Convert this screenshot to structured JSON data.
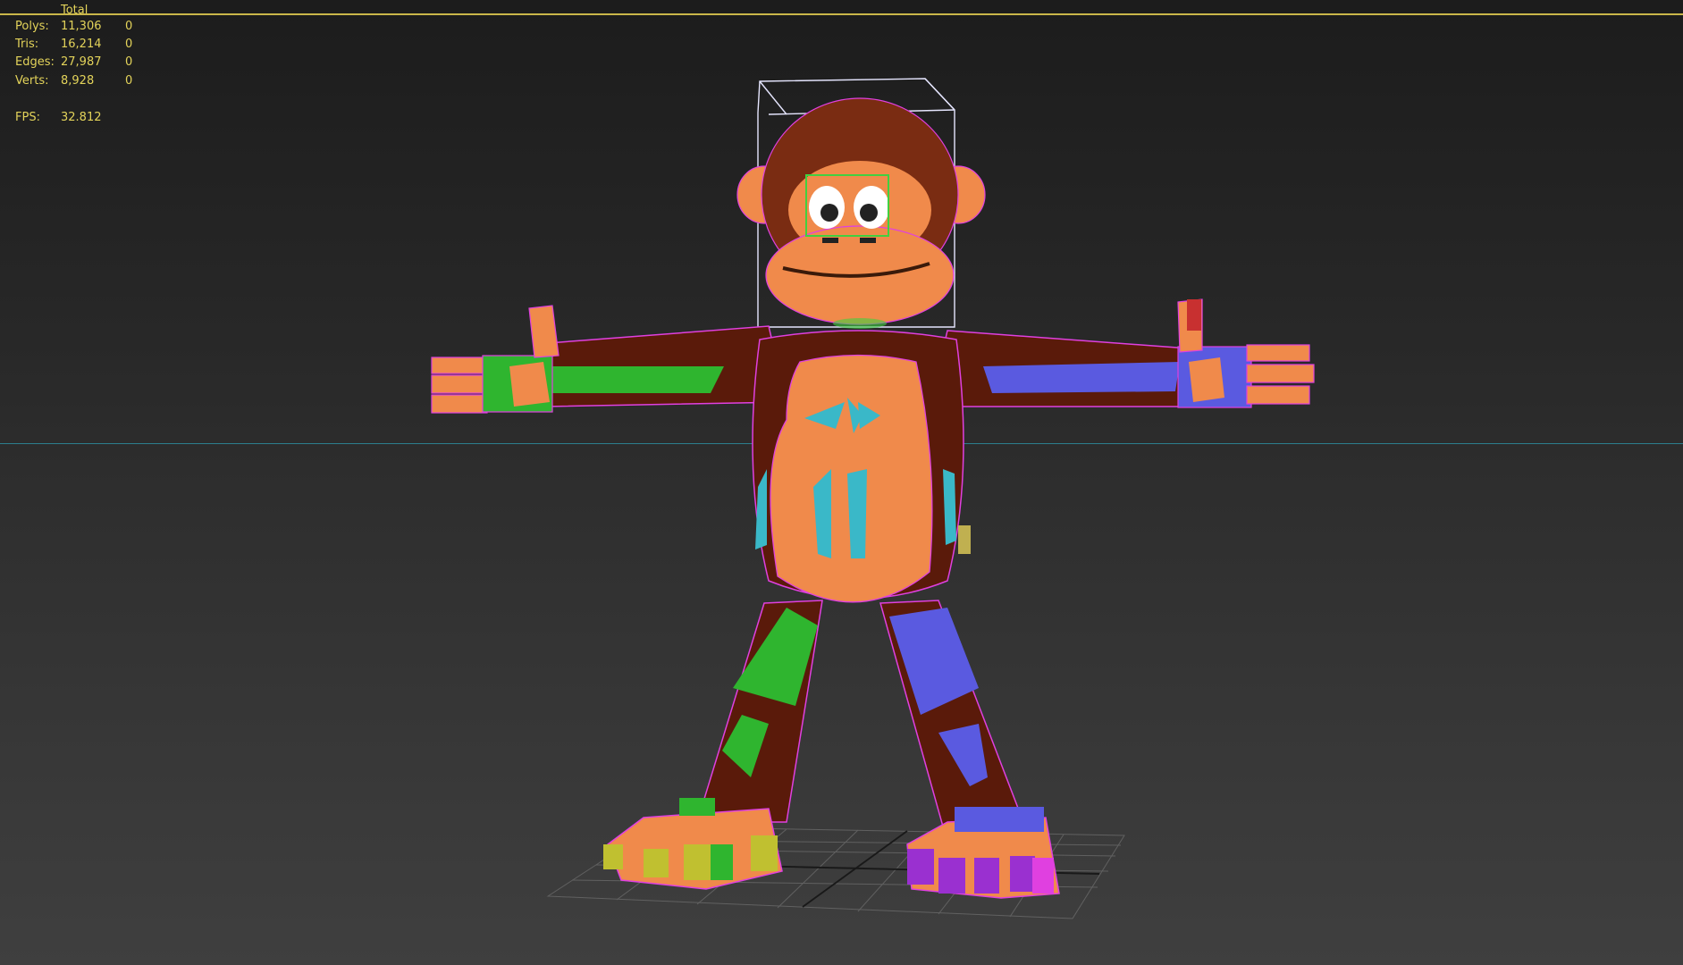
{
  "stats": {
    "header": "Total",
    "rows": [
      {
        "label": "Polys:",
        "value": "11,306",
        "selected": "0"
      },
      {
        "label": "Tris:",
        "value": "16,214",
        "selected": "0"
      },
      {
        "label": "Edges:",
        "value": "27,987",
        "selected": "0"
      },
      {
        "label": "Verts:",
        "value": "8,928",
        "selected": "0"
      }
    ],
    "fps_label": "FPS:",
    "fps_value": "32.812"
  },
  "colors": {
    "stats_text": "#e3d35a",
    "top_line": "#c9b64a",
    "horizon": "#2c7f8e",
    "skin_orange": "#f08a4b",
    "fur_brown": "#5a1a0a",
    "wire_magenta": "#e040e0",
    "left_limb_green": "#2fb52f",
    "right_limb_blue": "#5a5ae0",
    "torso_cyan": "#3ab8c8"
  }
}
